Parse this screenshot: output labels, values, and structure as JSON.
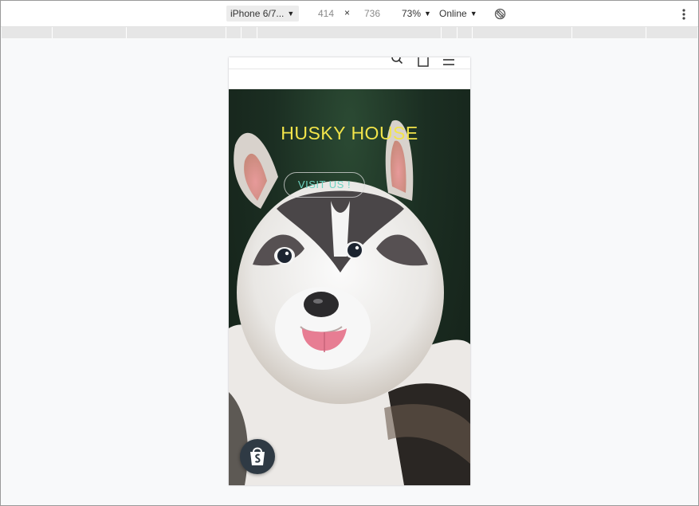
{
  "devtools": {
    "device": "iPhone 6/7...",
    "width": "414",
    "times": "×",
    "height": "736",
    "zoom": "73%",
    "network": "Online",
    "icons": [
      "caret-down-icon",
      "rotate-icon",
      "more-options-icon"
    ]
  },
  "site": {
    "header_icons": [
      "search-icon",
      "cart-icon",
      "menu-icon"
    ],
    "hero": {
      "title": "HUSKY HOUSE",
      "button": "VISIT US !",
      "image": "husky-puppy-photo"
    },
    "badge": "shopify-bag-icon"
  },
  "colors": {
    "title": "#f2e44a",
    "button_text": "#6fd3c2",
    "badge": "#2f3a44"
  }
}
